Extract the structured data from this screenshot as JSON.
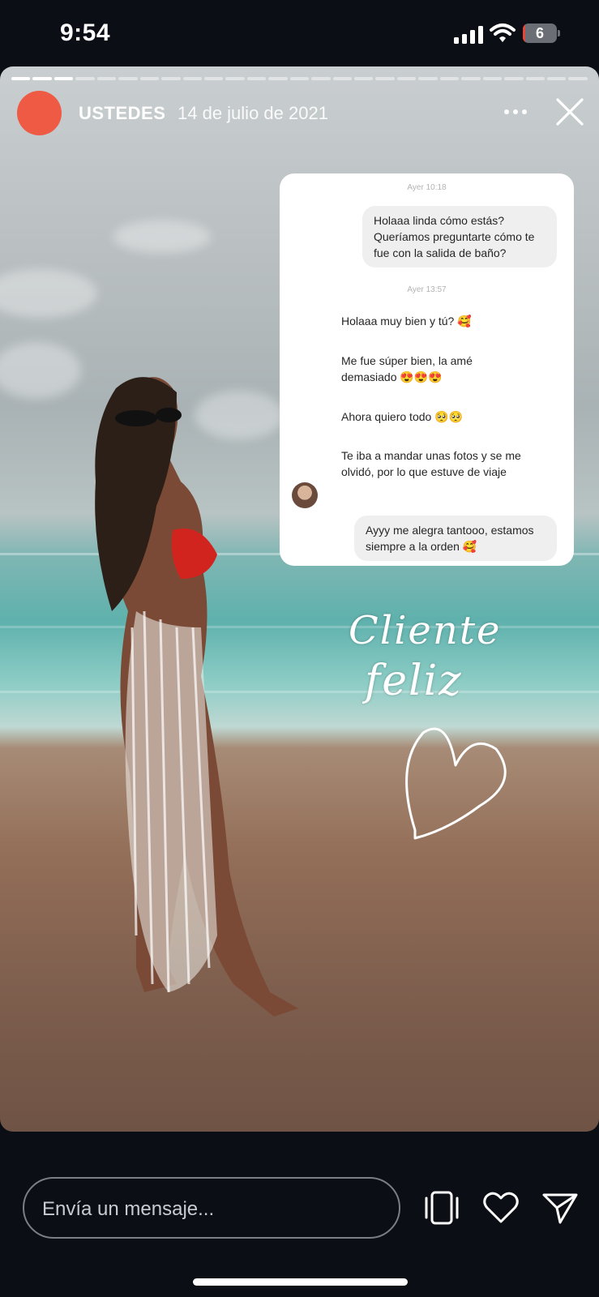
{
  "status_bar": {
    "time": "9:54",
    "battery_level": "6",
    "battery_color": "#e8443a"
  },
  "story": {
    "progress": {
      "total_segments": 27,
      "completed_segments": 3
    },
    "header": {
      "username": "USTEDES",
      "date": "14 de julio de 2021",
      "avatar_color": "#ee5a43",
      "more_icon": "more-horizontal-icon",
      "close_icon": "close-icon"
    },
    "chat_screenshot": {
      "timestamp_1": "Ayer 10:18",
      "outgoing_1": "Holaaa linda cómo estás? Queríamos preguntarte cómo te fue con la salida de baño?",
      "timestamp_2": "Ayer 13:57",
      "incoming": [
        "Holaaa muy bien y tú? 🥰",
        "Me fue súper bien, la amé demasiado 😍😍😍",
        "Ahora quiero todo 🥺🥺",
        "Te iba a mandar unas fotos y se me olvidó, por lo que estuve de viaje"
      ],
      "outgoing_2": "Ayyy me alegra tantooo, estamos siempre a la orden 🥰"
    },
    "handwriting": {
      "line_1": "Cliente",
      "line_2": "feliz"
    }
  },
  "footer": {
    "reply_placeholder": "Envía un mensaje...",
    "icons": [
      "device-frame-icon",
      "heart-icon",
      "send-icon"
    ]
  }
}
